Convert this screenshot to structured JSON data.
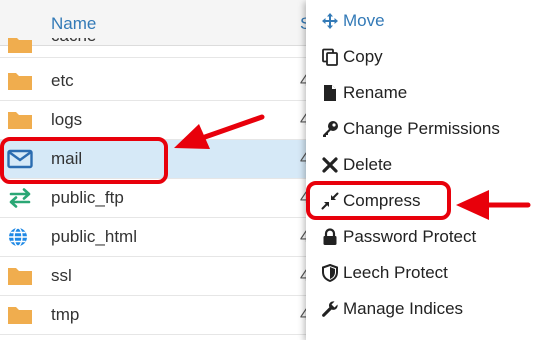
{
  "file_list": {
    "header": {
      "name_label": "Name",
      "size_label": "S"
    },
    "rows": [
      {
        "name": "cache",
        "type": "folder",
        "size": ""
      },
      {
        "name": "etc",
        "type": "folder",
        "size": "4"
      },
      {
        "name": "logs",
        "type": "folder",
        "size": "4"
      },
      {
        "name": "mail",
        "type": "mail",
        "size": "4",
        "selected": true
      },
      {
        "name": "public_ftp",
        "type": "ftp",
        "size": "4"
      },
      {
        "name": "public_html",
        "type": "web",
        "size": "4"
      },
      {
        "name": "ssl",
        "type": "folder",
        "size": "4"
      },
      {
        "name": "tmp",
        "type": "folder",
        "size": "4"
      }
    ]
  },
  "context_menu": {
    "items": [
      {
        "label": "Move",
        "icon": "move-icon"
      },
      {
        "label": "Copy",
        "icon": "copy-icon"
      },
      {
        "label": "Rename",
        "icon": "file-icon"
      },
      {
        "label": "Change Permissions",
        "icon": "key-icon"
      },
      {
        "label": "Delete",
        "icon": "x-icon"
      },
      {
        "label": "Compress",
        "icon": "compress-icon"
      },
      {
        "label": "Password Protect",
        "icon": "lock-icon"
      },
      {
        "label": "Leech Protect",
        "icon": "shield-icon"
      },
      {
        "label": "Manage Indices",
        "icon": "wrench-icon"
      }
    ]
  },
  "colors": {
    "link_blue": "#337ab7",
    "folder_yellow": "#f0ad4e",
    "selected_row": "#d6e9f7",
    "annotation_red": "#e8000b",
    "ftp_green": "#2aa775"
  }
}
